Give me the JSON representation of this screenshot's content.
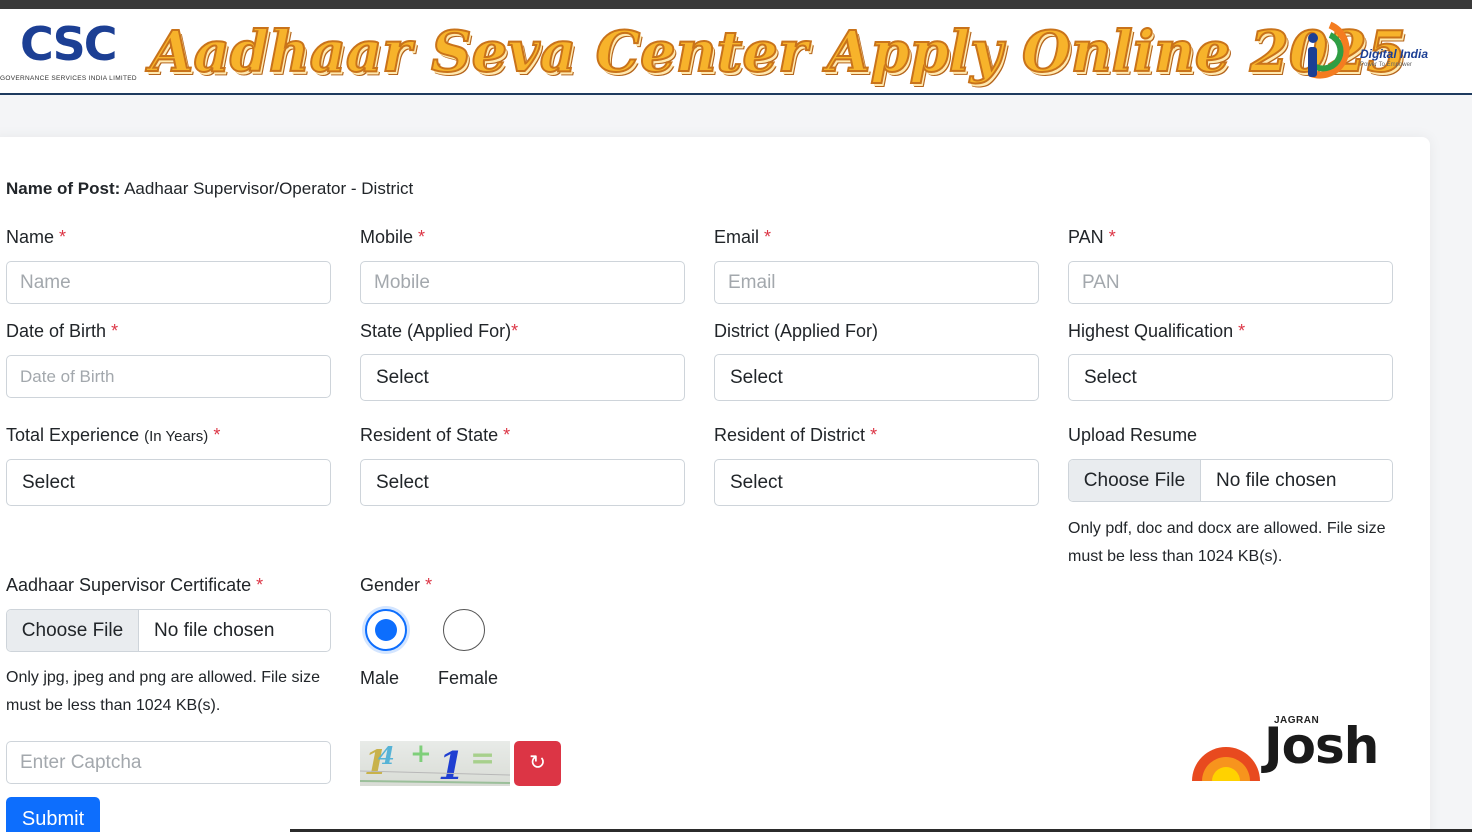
{
  "header": {
    "csc_logo_text": "CSC",
    "csc_logo_subtext": "GOVERNANCE SERVICES INDIA LIMITED",
    "banner_title": "Aadhaar Seva Center Apply Online 2025",
    "digital_india_text": "Digital India",
    "digital_india_tagline": "Power To Empower"
  },
  "post": {
    "label": "Name of Post:",
    "value": "Aadhaar Supervisor/Operator - District"
  },
  "fields": {
    "name": {
      "label": "Name",
      "required": "*",
      "placeholder": "Name"
    },
    "mobile": {
      "label": "Mobile",
      "required": "*",
      "placeholder": "Mobile"
    },
    "email": {
      "label": "Email",
      "required": "*",
      "placeholder": "Email"
    },
    "pan": {
      "label": "PAN",
      "required": "*",
      "placeholder": "PAN"
    },
    "dob": {
      "label": "Date of Birth",
      "required": "*",
      "placeholder": "Date of Birth"
    },
    "state_applied": {
      "label": "State (Applied For)",
      "required": "*",
      "value": "Select"
    },
    "district_applied": {
      "label": "District (Applied For)",
      "value": "Select"
    },
    "qualification": {
      "label": "Highest Qualification",
      "required": "*",
      "value": "Select"
    },
    "experience": {
      "label": "Total Experience",
      "label_small": "(In Years)",
      "required": "*",
      "value": "Select"
    },
    "resident_state": {
      "label": "Resident of State",
      "required": "*",
      "value": "Select"
    },
    "resident_district": {
      "label": "Resident of District",
      "required": "*",
      "value": "Select"
    },
    "resume": {
      "label": "Upload Resume",
      "button": "Choose File",
      "file_name": "No file chosen",
      "hint": "Only pdf, doc and docx are allowed. File size must be less than 1024 KB(s)."
    },
    "certificate": {
      "label": "Aadhaar Supervisor Certificate",
      "required": "*",
      "button": "Choose File",
      "file_name": "No file chosen",
      "hint": "Only jpg, jpeg and png are allowed. File size must be less than 1024 KB(s)."
    },
    "gender": {
      "label": "Gender",
      "required": "*",
      "options": [
        "Male",
        "Female"
      ],
      "selected": "Male"
    },
    "captcha": {
      "placeholder": "Enter Captcha",
      "image_text": [
        "1",
        "4",
        "+",
        "1",
        "="
      ],
      "refresh_icon": "↻"
    }
  },
  "submit_label": "Submit",
  "watermark": {
    "brand_small": "JAGRAN",
    "brand_word": "Josh"
  },
  "colors": {
    "primary": "#0d6efd",
    "danger": "#dc3545",
    "title_orange": "#f7b32b",
    "csc_blue": "#1c3f94"
  }
}
